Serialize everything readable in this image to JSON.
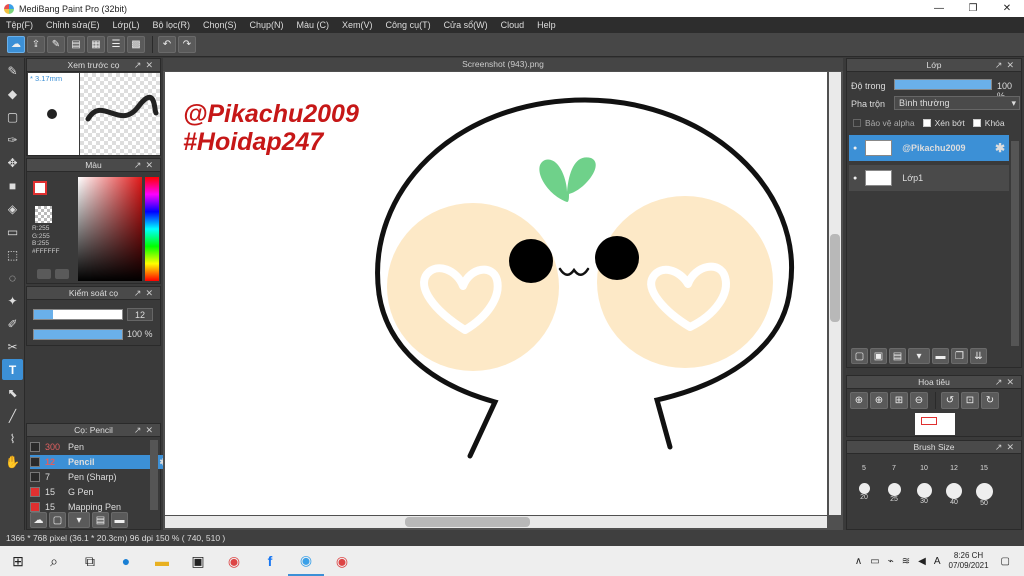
{
  "window": {
    "title": "MediBang Paint Pro (32bit)",
    "controls": [
      "—",
      "❐",
      "✕"
    ]
  },
  "menu": [
    "Tệp(F)",
    "Chỉnh sửa(E)",
    "Lớp(L)",
    "Bộ lọc(R)",
    "Chọn(S)",
    "Chụp(N)",
    "Màu (C)",
    "Xem(V)",
    "Công cụ(T)",
    "Cửa sổ(W)",
    "Cloud",
    "Help"
  ],
  "document": {
    "tab_title": "Screenshot (943).png",
    "watermark_line1": "@Pikachu2009",
    "watermark_line2": "#Hoidap247"
  },
  "brush_preview": {
    "title": "Xem trước cọ",
    "size_label": "* 3.17mm"
  },
  "color_panel": {
    "title": "Màu",
    "r": "R:255",
    "g": "G:255",
    "b": "B:255",
    "hex": "#FFFFFF"
  },
  "brush_control": {
    "title": "Kiểm soát cọ",
    "size": "12",
    "opacity": "100 %",
    "opacity_value": 1.0
  },
  "brush_list": {
    "title": "Cọ: Pencil",
    "items": [
      {
        "size": "300",
        "name": "Pen",
        "color": "#2a2a2a",
        "size_color": "#e06060",
        "selected": false
      },
      {
        "size": "12",
        "name": "Pencil",
        "color": "#2a2a2a",
        "size_color": "#e06060",
        "selected": true
      },
      {
        "size": "7",
        "name": "Pen (Sharp)",
        "color": "#2a2a2a",
        "size_color": "#dddddd",
        "selected": false
      },
      {
        "size": "15",
        "name": "G Pen",
        "color": "#e03030",
        "size_color": "#dddddd",
        "selected": false
      },
      {
        "size": "15",
        "name": "Mapping Pen",
        "color": "#e03030",
        "size_color": "#dddddd",
        "selected": false
      }
    ]
  },
  "layers_panel": {
    "title": "Lớp",
    "opacity_label": "Độ trong",
    "opacity_value": "100 %",
    "blend_label": "Pha trộn",
    "blend_value": "Bình thường",
    "protect_alpha": "Bảo vệ alpha",
    "clipping": "Xén bớt",
    "lock": "Khóa",
    "layers": [
      {
        "name": "@Pikachu2009",
        "selected": true
      },
      {
        "name": "Lớp1",
        "selected": false
      }
    ]
  },
  "navigator": {
    "title": "Hoa tiêu"
  },
  "brush_size": {
    "title": "Brush Size",
    "row1": [
      "5",
      "7",
      "10",
      "12",
      "15"
    ],
    "row2": [
      "20",
      "25",
      "30",
      "40",
      "50"
    ]
  },
  "status": {
    "text": "1366 * 768 pixel   (36.1 * 20.3cm)   96 dpi   150 %   ( 740, 510 )"
  },
  "taskbar": {
    "time": "8:26 CH",
    "date": "07/09/2021"
  },
  "colors": {
    "accent": "#3c90d6",
    "panel_bg": "#3a3a3a",
    "cheek": "#fde9c7",
    "sprout": "#6fd18a"
  }
}
